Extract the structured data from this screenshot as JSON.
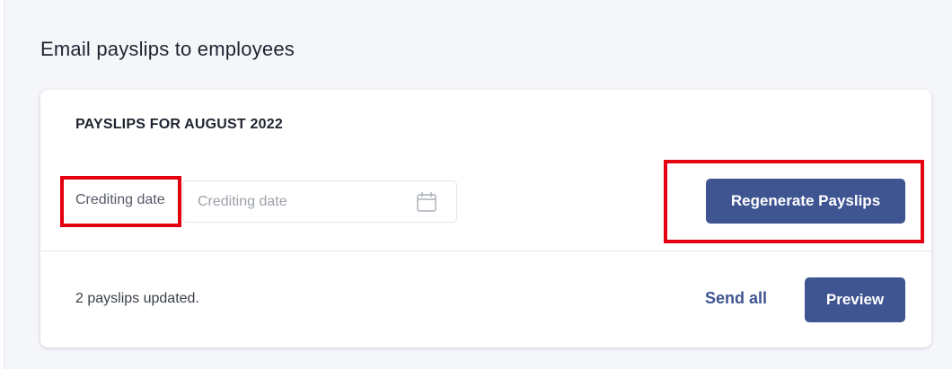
{
  "page": {
    "title": "Email payslips to employees"
  },
  "card": {
    "heading": "PAYSLIPS FOR AUGUST 2022",
    "crediting_date": {
      "label": "Crediting date",
      "placeholder": "Crediting date",
      "value": ""
    },
    "regenerate_button_label": "Regenerate Payslips",
    "status_text": "2 payslips updated.",
    "send_all_label": "Send all",
    "preview_button_label": "Preview"
  },
  "icons": {
    "date_picker": "calendar-icon"
  },
  "colors": {
    "primary": "#3f5591",
    "highlight": "#e3000f",
    "page_background": "#f5f6fa"
  }
}
